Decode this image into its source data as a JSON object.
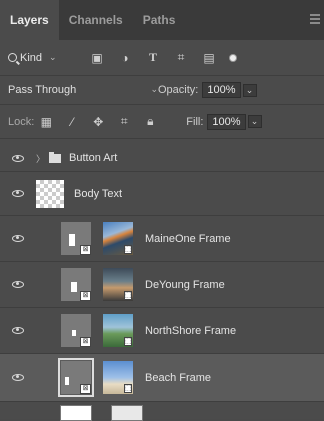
{
  "tabs": [
    {
      "label": "Layers",
      "active": true
    },
    {
      "label": "Channels",
      "active": false
    },
    {
      "label": "Paths",
      "active": false
    }
  ],
  "filter": {
    "kind_label": "Kind",
    "icons": [
      "image-filter-icon",
      "adjustment-filter-icon",
      "type-filter-icon",
      "shape-filter-icon",
      "smart-object-filter-icon",
      "filter-toggle-icon"
    ]
  },
  "blend": {
    "mode": "Pass Through",
    "opacity_label": "Opacity:",
    "opacity_value": "100%"
  },
  "lock": {
    "label": "Lock:",
    "fill_label": "Fill:",
    "fill_value": "100%"
  },
  "layers": [
    {
      "name": "Button Art",
      "type": "group"
    },
    {
      "name": "Body Text",
      "type": "text"
    },
    {
      "name": "MaineOne Frame",
      "type": "frame"
    },
    {
      "name": "DeYoung Frame",
      "type": "frame"
    },
    {
      "name": "NorthShore Frame",
      "type": "frame"
    },
    {
      "name": "Beach Frame",
      "type": "frame",
      "selected": true
    }
  ],
  "colors": {
    "panel_bg": "#4b4b4b",
    "tab_bar_bg": "#3a3a3a",
    "selected_row": "#5b5b5b",
    "text": "#e4e4e4"
  }
}
